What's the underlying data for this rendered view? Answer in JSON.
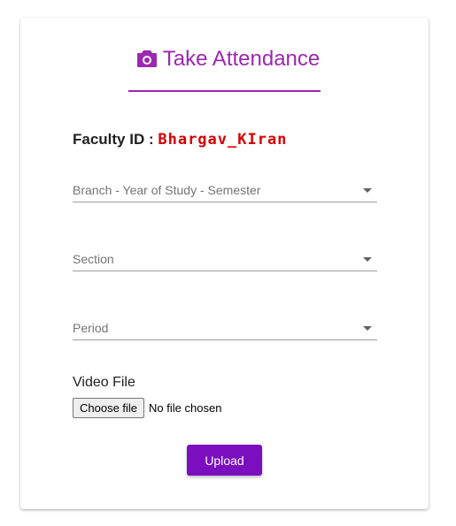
{
  "header": {
    "title": "Take Attendance",
    "icon": "camera-icon",
    "accent_color": "#9c27b0"
  },
  "faculty": {
    "label": "Faculty ID :",
    "id_value": "Bhargav_KIran",
    "id_color": "#d50000"
  },
  "form": {
    "branch_select": {
      "placeholder": "Branch - Year of Study - Semester"
    },
    "section_select": {
      "placeholder": "Section"
    },
    "period_select": {
      "placeholder": "Period"
    },
    "video": {
      "label": "Video File",
      "button_label": "Choose file",
      "status": "No file chosen"
    },
    "upload_label": "Upload",
    "upload_color": "#7b0fbf"
  }
}
